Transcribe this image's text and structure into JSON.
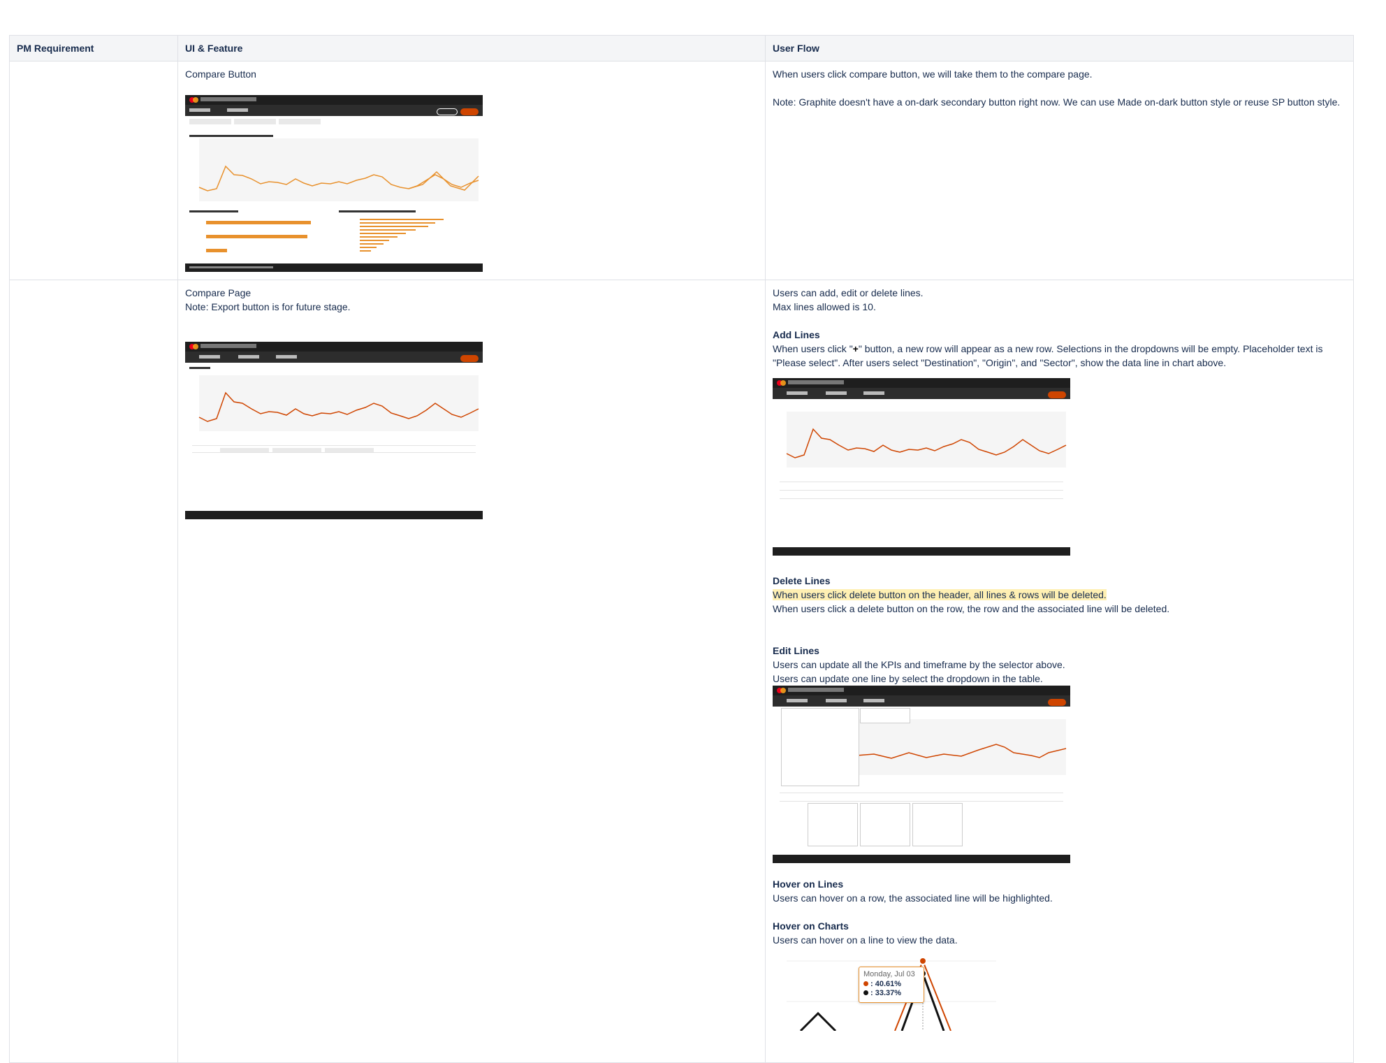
{
  "headers": [
    "PM Requirement",
    "UI & Feature",
    "User Flow"
  ],
  "row1": {
    "feature_title": "Compare Button",
    "flow_lines": [
      "When users click compare button, we will take them to the compare page.",
      "Note: Graphite doesn't have a on-dark secondary button right now. We can use Made on-dark button style or reuse SP button style."
    ]
  },
  "row2": {
    "feature_lines": [
      "Compare Page",
      "Note: Export button is for future stage."
    ],
    "intro_lines": [
      "Users can add, edit or delete lines.",
      "Max lines allowed is 10."
    ],
    "add": {
      "heading": "Add Lines",
      "text_before": "When users click \"",
      "plus": "+",
      "text_after": "\" button, a new row will appear as a new row. Selections in the dropdowns will be empty. Placeholder text is \"Please select\". After users select \"Destination\", \"Origin\", and \"Sector\", show the data line in chart above."
    },
    "delete": {
      "heading": "Delete Lines",
      "highlighted": "When users click delete button on the header, all lines & rows will be deleted.",
      "text": "When users click a delete button on the row, the row and the associated line will be deleted."
    },
    "edit": {
      "heading": "Edit Lines",
      "lines": [
        "Users can update all the KPIs and timeframe by the selector above.",
        "Users can update one line by select the dropdown in the table."
      ]
    },
    "hover_lines": {
      "heading": "Hover on Lines",
      "text": "Users can hover on a row, the associated line will be highlighted."
    },
    "hover_charts": {
      "heading": "Hover on Charts",
      "text": "Users can hover on a line to view the data."
    },
    "tooltip": {
      "date": "Monday, Jul 03",
      "value1": ": 40.61%",
      "value2": ": 33.37%"
    }
  },
  "colors": {
    "accent": "#cf4500",
    "line": "#e8912d",
    "dark": "#1e1e1e",
    "highlight": "#fff0b3",
    "border": "#dfe1e6"
  }
}
